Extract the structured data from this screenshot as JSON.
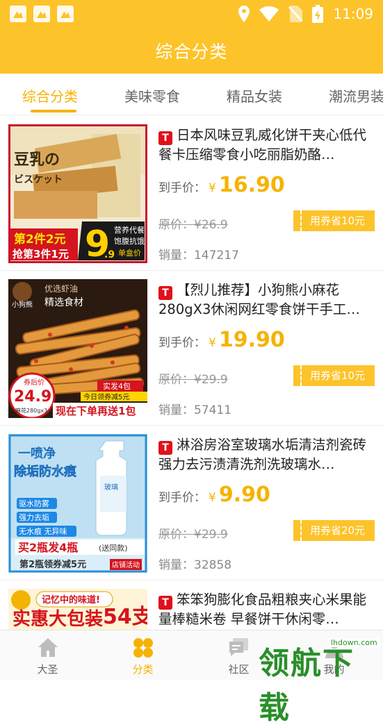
{
  "status_bar": {
    "time": "11:09",
    "left_icons": [
      "notification-icon",
      "notification-icon",
      "shopping-bag-icon"
    ],
    "right_icons": [
      "location-icon",
      "wifi-icon",
      "no-sim-icon",
      "battery-charging-icon"
    ]
  },
  "header": {
    "title": "综合分类"
  },
  "tabs": [
    {
      "label": "综合分类",
      "active": true
    },
    {
      "label": "美味零食",
      "active": false
    },
    {
      "label": "精品女装",
      "active": false
    },
    {
      "label": "潮流男装",
      "active": false
    }
  ],
  "labels": {
    "final_price": "到手价：",
    "currency": "¥",
    "original_prefix": "原价：",
    "sales_prefix": "销量：",
    "tmall_badge": "T"
  },
  "products": [
    {
      "title": "日本风味豆乳威化饼干夹心低代餐卡压缩零食小吃丽脂奶酪…",
      "final_price": "16.90",
      "original_price": "¥26.9",
      "coupon": "用券省10元",
      "sales": "147217",
      "image_text": {
        "main": "豆乳の",
        "sub": "ビスケット",
        "promo1": "第2件2元",
        "promo2": "抢第3件1元",
        "big": "9",
        "small": ".9",
        "tag1": "营养代餐",
        "tag2": "饱腹抗饿",
        "tag3": "单盒价"
      }
    },
    {
      "title": "【烈儿推荐】小狗熊小麻花280gX3休闲网红零食饼干手工…",
      "final_price": "19.90",
      "original_price": "¥29.9",
      "coupon": "用券省10元",
      "sales": "57411",
      "image_text": {
        "brand": "小狗熊",
        "tag1": "优选虾油",
        "tag2": "精选食材",
        "price_label": "券后价",
        "price": "24.9",
        "weight": "麻花280gx3",
        "badge1": "实发4包",
        "badge2": "今日领券减5元",
        "banner": "现在下单再送1包"
      }
    },
    {
      "title": "淋浴房浴室玻璃水垢清洁剂瓷砖强力去污渍清洗剂洗玻璃水…",
      "final_price": "9.90",
      "original_price": "¥29.9",
      "coupon": "用券省20元",
      "sales": "32858",
      "image_text": {
        "l1": "一喷净",
        "l2": "除垢防水痕",
        "f1": "驱水防雾",
        "f2": "强力去垢",
        "f3": "无水痕 无异味",
        "banner": "买2瓶发4瓶",
        "same": "(送同款)",
        "bottom": "第2瓶领券减5元",
        "shop": "店铺活动",
        "label": "玻璃"
      }
    },
    {
      "title": "笨笨狗膨化食品粗粮夹心米果能量棒糙米卷 早餐饼干休闲零…",
      "final_price": "",
      "original_price": "",
      "coupon": "",
      "sales": "",
      "image_text": {
        "tag": "记忆中的味道!",
        "main": "实惠大包装",
        "big": "54支"
      }
    }
  ],
  "bottom_nav": [
    {
      "label": "大圣",
      "icon": "home-icon",
      "active": false
    },
    {
      "label": "分类",
      "icon": "category-icon",
      "active": true
    },
    {
      "label": "社区",
      "icon": "community-icon",
      "active": false
    },
    {
      "label": "我的",
      "icon": "profile-icon",
      "active": false
    }
  ],
  "watermark": {
    "text": "领航下载",
    "url": "lhdown.com"
  },
  "colors": {
    "brand": "#fdc32a",
    "accent": "#f5b300",
    "tmall": "#e0101a"
  }
}
